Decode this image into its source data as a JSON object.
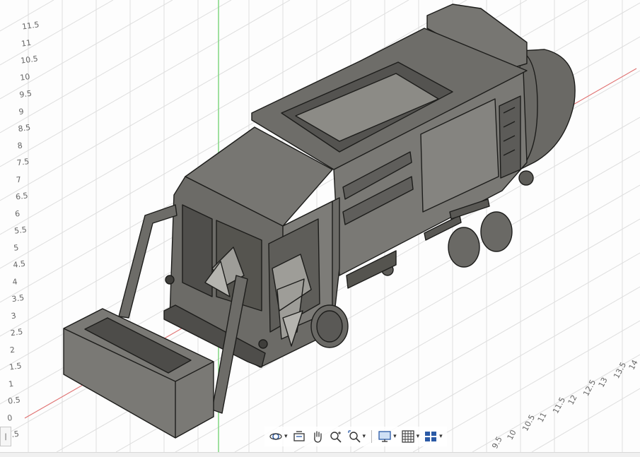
{
  "viewport": {
    "left_ruler_labels": [
      "0.5",
      "0",
      "0.5",
      "1",
      "1.5",
      "2",
      "2.5",
      "3",
      "3.5",
      "4",
      "4.5",
      "5",
      "5.5",
      "6",
      "6.5",
      "7",
      "7.5",
      "8",
      "8.5",
      "9",
      "9.5",
      "10",
      "10.5",
      "11",
      "11.5"
    ],
    "right_ruler_labels": [
      "9.5",
      "10",
      "10.5",
      "11",
      "11.5",
      "12",
      "12.5",
      "13",
      "13.5",
      "14"
    ]
  },
  "navigation_toolbar": {
    "items": [
      {
        "name": "orbit-icon",
        "has_dropdown": true
      },
      {
        "name": "look-at-icon",
        "has_dropdown": false
      },
      {
        "name": "pan-hand-icon",
        "has_dropdown": false
      },
      {
        "name": "zoom-icon",
        "has_dropdown": false
      },
      {
        "name": "fit-zoom-icon",
        "has_dropdown": true
      },
      {
        "name": "display-settings-icon",
        "has_dropdown": true
      },
      {
        "name": "grid-settings-icon",
        "has_dropdown": true
      },
      {
        "name": "viewports-icon",
        "has_dropdown": true
      }
    ]
  },
  "side_tab": {
    "label": "|"
  },
  "colors": {
    "model_fill": "#6e6d69",
    "model_dark": "#4a4946",
    "model_edge": "#1d1d1b",
    "grid_line": "#dedede",
    "axis_red": "#e07070",
    "axis_green": "#6fd16f",
    "toolbar_icon": "#2b5aa6"
  }
}
